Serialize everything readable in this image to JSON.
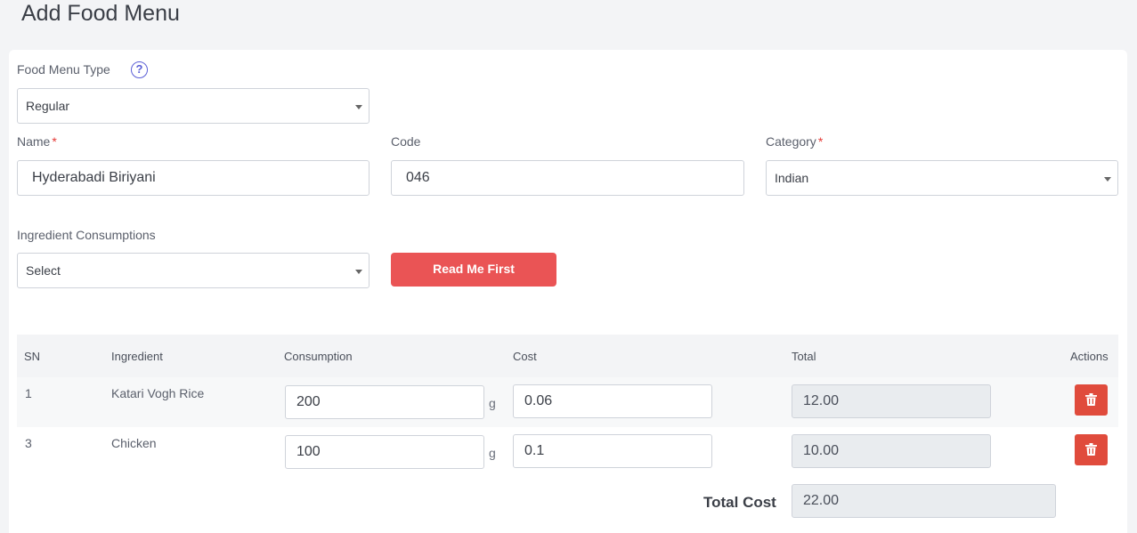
{
  "page": {
    "title": "Add Food Menu"
  },
  "form": {
    "menu_type": {
      "label": "Food Menu Type",
      "value": "Regular"
    },
    "name": {
      "label": "Name",
      "required_mark": "*",
      "value": "Hyderabadi Biriyani"
    },
    "code": {
      "label": "Code",
      "value": "046"
    },
    "category": {
      "label": "Category",
      "required_mark": "*",
      "value": "Indian"
    },
    "ingredients": {
      "label": "Ingredient Consumptions",
      "value": "Select"
    },
    "read_me_label": "Read Me First"
  },
  "table": {
    "headers": {
      "sn": "SN",
      "ingredient": "Ingredient",
      "consumption": "Consumption",
      "cost": "Cost",
      "total": "Total",
      "actions": "Actions"
    },
    "rows": [
      {
        "sn": "1",
        "ingredient": "Katari Vogh Rice",
        "consumption": "200",
        "unit": "g",
        "cost": "0.06",
        "total": "12.00"
      },
      {
        "sn": "3",
        "ingredient": "Chicken",
        "consumption": "100",
        "unit": "g",
        "cost": "0.1",
        "total": "10.00"
      }
    ],
    "total_cost_label": "Total Cost",
    "total_cost": "22.00"
  },
  "icons": {
    "help": "question-circle-icon",
    "delete": "trash-icon"
  },
  "colors": {
    "primary_button": "#ea5455",
    "delete_button": "#e04b3c",
    "help_icon": "#5b5fd6"
  }
}
